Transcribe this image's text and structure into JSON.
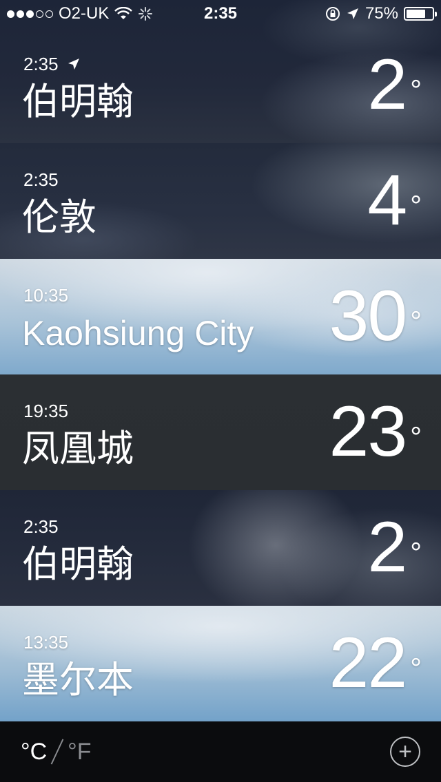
{
  "status_bar": {
    "carrier": "O2-UK",
    "time": "2:35",
    "battery": "75%",
    "battery_fraction": 0.75,
    "signal_dots_filled": 3,
    "signal_dots_total": 5
  },
  "cities": [
    {
      "time": "2:35",
      "name": "伯明翰",
      "temp": "2",
      "deg": "°",
      "current_location": true
    },
    {
      "time": "2:35",
      "name": "伦敦",
      "temp": "4",
      "deg": "°"
    },
    {
      "time": "10:35",
      "name": "Kaohsiung City",
      "temp": "30",
      "deg": "°"
    },
    {
      "time": "19:35",
      "name": "凤凰城",
      "temp": "23",
      "deg": "°"
    },
    {
      "time": "2:35",
      "name": "伯明翰",
      "temp": "2",
      "deg": "°"
    },
    {
      "time": "13:35",
      "name": "墨尔本",
      "temp": "22",
      "deg": "°"
    }
  ],
  "toolbar": {
    "unit_c": "°C",
    "unit_f": "°F",
    "add_symbol": "+"
  },
  "icons": {
    "wifi": "wifi-icon",
    "activity": "activity-spinner-icon",
    "rotation_lock": "rotation-lock-icon",
    "location": "location-arrow-icon",
    "battery": "battery-icon",
    "add": "add-icon"
  }
}
